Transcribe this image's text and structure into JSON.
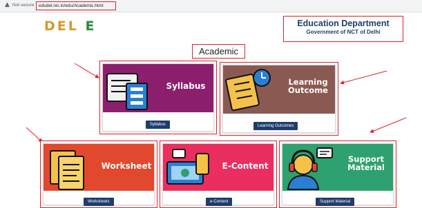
{
  "browser": {
    "security_label": "Not secure",
    "url": "edudel.nic.in/edu/Academic.html"
  },
  "header": {
    "logo_text_main": "DEL",
    "logo_text_end": "E",
    "department_title": "Education Department",
    "department_subtitle": "Government of NCT of Delhi"
  },
  "section_title": "Academic",
  "cards": [
    {
      "title": "Syllabus",
      "button": "Syllabus",
      "color": "#8b1f6e",
      "icon": "books-icon"
    },
    {
      "title": "Learning\nOutcome",
      "button": "Learning Outcomes",
      "color": "#8a5a52",
      "icon": "checklist-clock-icon"
    },
    {
      "title": "Worksheet",
      "button": "Worksheets",
      "color": "#e2482d",
      "icon": "documents-icon"
    },
    {
      "title": "E-Content",
      "button": "e-Content",
      "color": "#ea2e5f",
      "icon": "devices-icon"
    },
    {
      "title": "Support\nMaterial",
      "button": "Support Material",
      "color": "#2fa06f",
      "icon": "headset-support-icon"
    }
  ],
  "colors": {
    "highlight": "#e0202a",
    "button_bg": "#1f3d6b",
    "heading": "#1f3d6b"
  }
}
